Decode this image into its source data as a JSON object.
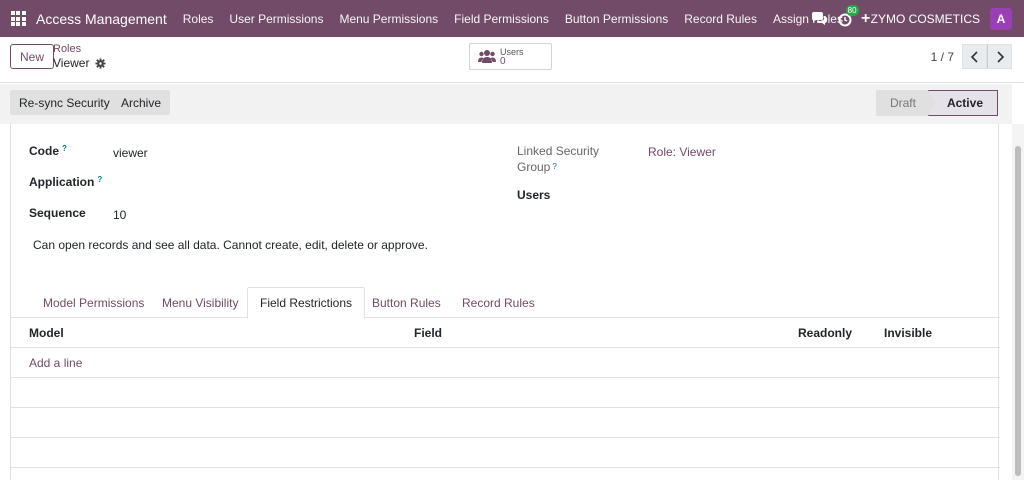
{
  "navbar": {
    "app_name": "Access Management",
    "menu": [
      "Roles",
      "User Permissions",
      "Menu Permissions",
      "Field Permissions",
      "Button Permissions",
      "Record Rules",
      "Assign Roles"
    ],
    "plus": "+",
    "activity_count": "80",
    "company": "ZYMO COSMETICS",
    "avatar_letter": "A"
  },
  "control": {
    "new_label": "New",
    "breadcrumb_parent": "Roles",
    "breadcrumb_current": "Viewer",
    "users_stat_label": "Users",
    "users_stat_value": "0",
    "pager": "1 / 7"
  },
  "header": {
    "resync_label": "Re-sync Security",
    "archive_label": "Archive",
    "status_steps": [
      "Draft",
      "Active"
    ],
    "current_status": "Active"
  },
  "form": {
    "code_label": "Code",
    "code_value": "viewer",
    "application_label": "Application",
    "application_value": "",
    "sequence_label": "Sequence",
    "sequence_value": "10",
    "description": "Can open records and see all data. Cannot create, edit, delete or approve.",
    "linked_group_label_1": "Linked Security",
    "linked_group_label_2": "Group",
    "linked_group_value": "Role: Viewer",
    "users_label": "Users",
    "help_mark": "?"
  },
  "tabs": [
    "Model Permissions",
    "Menu Visibility",
    "Field Restrictions",
    "Button Rules",
    "Record Rules"
  ],
  "active_tab": "Field Restrictions",
  "list": {
    "columns": [
      "Model",
      "Field",
      "Readonly",
      "Invisible"
    ],
    "add_line": "Add a line"
  },
  "colors": {
    "brand": "#714b67",
    "badge": "#28a745",
    "avatar": "#9b3fb5"
  }
}
